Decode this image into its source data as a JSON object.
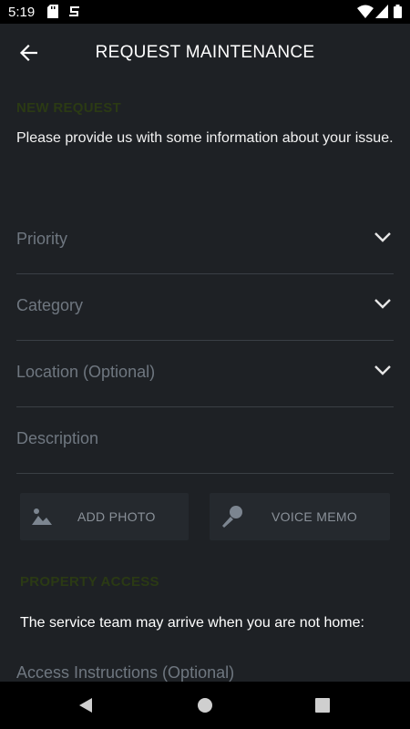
{
  "status_bar": {
    "time": "5:19",
    "icons": [
      "sd-card-icon",
      "sync-icon",
      "wifi-icon",
      "cellular-icon",
      "battery-icon"
    ]
  },
  "app_bar": {
    "title": "REQUEST MAINTENANCE",
    "back_icon": "back-arrow-icon"
  },
  "new_request": {
    "section_label": "NEW REQUEST",
    "intro": "Please provide us with some information about your issue."
  },
  "fields": [
    {
      "label": "Priority",
      "icon": "chevron-down-icon"
    },
    {
      "label": "Category",
      "icon": "chevron-down-icon"
    },
    {
      "label": "Location (Optional)",
      "icon": "chevron-down-icon"
    },
    {
      "label": "Description"
    }
  ],
  "media": {
    "add_photo": {
      "label": "ADD PHOTO",
      "icon": "photo-icon"
    },
    "voice_memo": {
      "label": "VOICE MEMO",
      "icon": "microphone-icon"
    }
  },
  "property_access": {
    "section_label": "PROPERTY ACCESS",
    "note": "The service team may arrive when you are not home:",
    "instructions_label": "Access Instructions (Optional)"
  },
  "nav_bar": {
    "icons": [
      "nav-back-icon",
      "nav-home-icon",
      "nav-recents-icon"
    ]
  },
  "colors": {
    "background": "#1e2125",
    "section_label": "#2b3a14",
    "field_label": "#6f7780",
    "divider": "#3a3f45",
    "button_bg": "#25292e"
  }
}
